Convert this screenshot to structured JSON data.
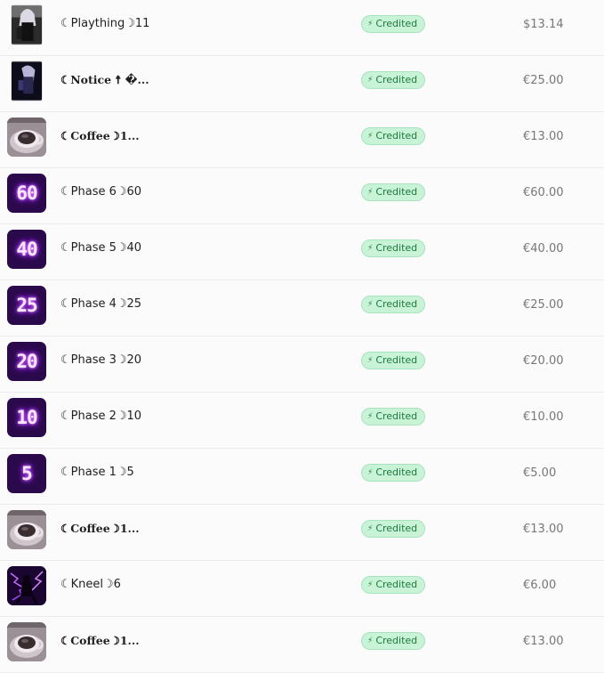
{
  "transactions": [
    {
      "title": "☾Plaything☽11",
      "serif": false,
      "thumb": "photo-doll",
      "status": "Credited",
      "amount": "$13.14"
    },
    {
      "title": "☾Notice ☨ �...",
      "serif": true,
      "thumb": "photo-dark-figure",
      "status": "Credited",
      "amount": "€25.00"
    },
    {
      "title": "☾Coffee☽1...",
      "serif": true,
      "thumb": "coffee-cup",
      "status": "Credited",
      "amount": "€13.00"
    },
    {
      "title": "☾Phase 6☽60",
      "serif": false,
      "thumb": "neon-number",
      "badge_number": "60",
      "status": "Credited",
      "amount": "€60.00"
    },
    {
      "title": "☾Phase 5☽40",
      "serif": false,
      "thumb": "neon-number",
      "badge_number": "40",
      "status": "Credited",
      "amount": "€40.00"
    },
    {
      "title": "☾Phase 4☽25",
      "serif": false,
      "thumb": "neon-number",
      "badge_number": "25",
      "status": "Credited",
      "amount": "€25.00"
    },
    {
      "title": "☾Phase 3☽20",
      "serif": false,
      "thumb": "neon-number",
      "badge_number": "20",
      "status": "Credited",
      "amount": "€20.00"
    },
    {
      "title": "☾Phase 2☽10",
      "serif": false,
      "thumb": "neon-number",
      "badge_number": "10",
      "status": "Credited",
      "amount": "€10.00"
    },
    {
      "title": "☾Phase 1☽5",
      "serif": false,
      "thumb": "neon-number",
      "badge_number": "5",
      "status": "Credited",
      "amount": "€5.00"
    },
    {
      "title": "☾Coffee☽1...",
      "serif": true,
      "thumb": "coffee-cup",
      "status": "Credited",
      "amount": "€13.00"
    },
    {
      "title": "☾Kneel☽6",
      "serif": false,
      "thumb": "purple-lightning-figure",
      "status": "Credited",
      "amount": "€6.00"
    },
    {
      "title": "☾Coffee☽1...",
      "serif": true,
      "thumb": "coffee-cup",
      "status": "Credited",
      "amount": "€13.00"
    }
  ],
  "status_icon": "lightning-bolt-icon",
  "colors": {
    "badge_bg": "#c9f3d7",
    "badge_border": "#a8e3bd",
    "badge_text": "#1d7a3e",
    "neon_bg": "#2a0a4a",
    "neon_glow": "#b13cff",
    "amount_text": "#777777"
  }
}
